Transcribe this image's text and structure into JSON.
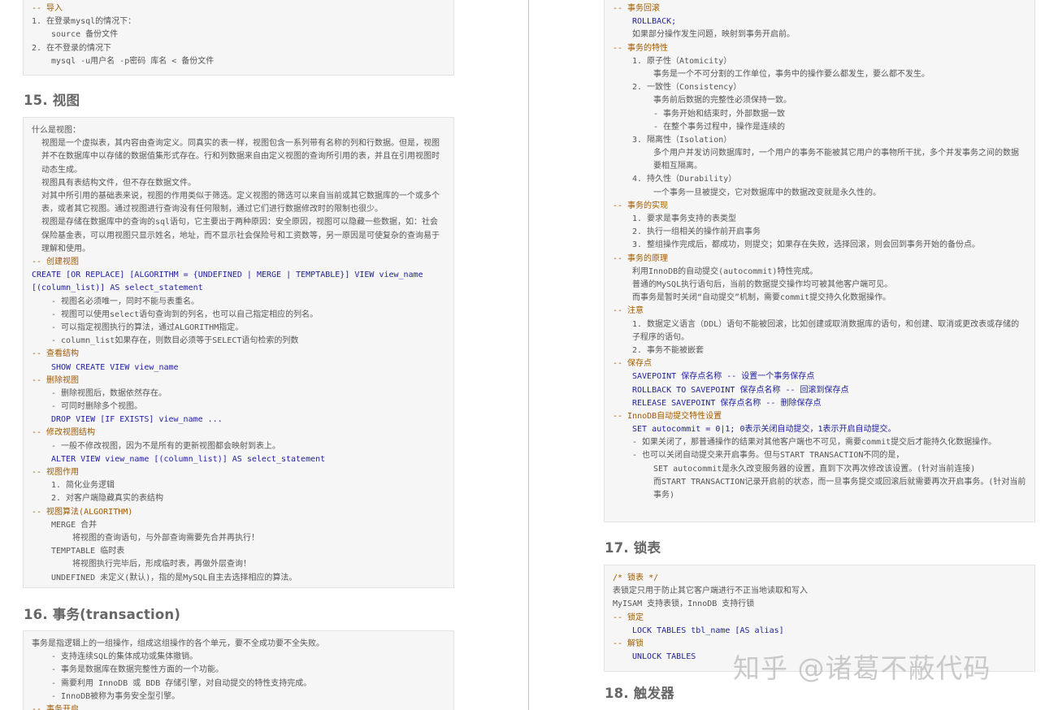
{
  "left": {
    "top_block": [
      {
        "t": "-- 导入",
        "cls": "c-comment"
      },
      {
        "t": "1. 在登录mysql的情况下：",
        "cls": "c-gray",
        "num": "1."
      },
      {
        "t": "source  备份文件",
        "cls": "c-gray",
        "ind": 2
      },
      {
        "t": "2. 在不登录的情况下",
        "cls": "c-gray",
        "num": "2."
      },
      {
        "t": "mysql -u用户名 -p密码 库名 < 备份文件",
        "cls": "c-gray",
        "ind": 2
      }
    ],
    "section15": {
      "title": "15. 视图",
      "lines": [
        {
          "t": "什么是视图：",
          "cls": "c-gray"
        },
        {
          "t": "视图是一个虚拟表，其内容由查询定义。同真实的表一样，视图包含一系列带有名称的列和行数据。但是，视图并不在数据库中以存储的数据值集形式存在。行和列数据来自由定义视图的查询所引用的表，并且在引用视图时动态生成。",
          "cls": "c-gray",
          "wrap": true,
          "ind": 1
        },
        {
          "t": "视图具有表结构文件，但不存在数据文件。",
          "cls": "c-gray",
          "ind": 1
        },
        {
          "t": "对其中所引用的基础表来说，视图的作用类似于筛选。定义视图的筛选可以来自当前或其它数据库的一个或多个表，或者其它视图。通过视图进行查询没有任何限制，通过它们进行数据修改时的限制也很少。",
          "cls": "c-gray",
          "wrap": true,
          "ind": 1
        },
        {
          "t": "视图是存储在数据库中的查询的sql语句，它主要出于两种原因：安全原因，视图可以隐藏一些数据，如：社会保险基金表，可以用视图只显示姓名，地址，而不显示社会保险号和工资数等，另一原因是可使复杂的查询易于理解和使用。",
          "cls": "c-gray",
          "wrap": true,
          "ind": 1
        },
        {
          "t": "-- 创建视图",
          "cls": "c-comment"
        },
        {
          "t": "CREATE [OR REPLACE] [ALGORITHM = {UNDEFINED | MERGE | TEMPTABLE}] VIEW view_name [(column_list)] AS select_statement",
          "cls": "c-kw",
          "wrap": true
        },
        {
          "t": "- 视图名必须唯一，同时不能与表重名。",
          "cls": "c-gray",
          "ind": 2
        },
        {
          "t": "- 视图可以使用select语句查询到的列名，也可以自己指定相应的列名。",
          "cls": "c-gray",
          "ind": 2
        },
        {
          "t": "- 可以指定视图执行的算法，通过ALGORITHM指定。",
          "cls": "c-gray",
          "ind": 2
        },
        {
          "t": "- column_list如果存在，则数目必须等于SELECT语句检索的列数",
          "cls": "c-gray",
          "ind": 2
        },
        {
          "t": "-- 查看结构",
          "cls": "c-comment"
        },
        {
          "t": "SHOW CREATE VIEW view_name",
          "cls": "c-kw",
          "ind": 2
        },
        {
          "t": "-- 删除视图",
          "cls": "c-comment"
        },
        {
          "t": "- 删除视图后，数据依然存在。",
          "cls": "c-gray",
          "ind": 2
        },
        {
          "t": "- 可同时删除多个视图。",
          "cls": "c-gray",
          "ind": 2
        },
        {
          "t": "DROP VIEW [IF EXISTS] view_name ...",
          "cls": "c-kw",
          "ind": 2
        },
        {
          "t": "-- 修改视图结构",
          "cls": "c-comment"
        },
        {
          "t": "- 一般不修改视图，因为不是所有的更新视图都会映射到表上。",
          "cls": "c-gray",
          "ind": 2
        },
        {
          "t": "ALTER VIEW view_name [(column_list)] AS select_statement",
          "cls": "c-kw",
          "ind": 2
        },
        {
          "t": "-- 视图作用",
          "cls": "c-comment"
        },
        {
          "t": "1. 简化业务逻辑",
          "cls": "c-gray",
          "ind": 2,
          "num": "1."
        },
        {
          "t": "2. 对客户端隐藏真实的表结构",
          "cls": "c-gray",
          "ind": 2,
          "num": "2."
        },
        {
          "t": "-- 视图算法(ALGORITHM)",
          "cls": "c-comment"
        },
        {
          "t": "MERGE        合并",
          "cls": "c-gray",
          "ind": 2
        },
        {
          "t": "将视图的查询语句，与外部查询需要先合并再执行！",
          "cls": "c-gray",
          "ind": 3
        },
        {
          "t": "TEMPTABLE    临时表",
          "cls": "c-gray",
          "ind": 2
        },
        {
          "t": "将视图执行完毕后，形成临时表，再做外层查询！",
          "cls": "c-gray",
          "ind": 3
        },
        {
          "t": "UNDEFINED    未定义(默认)，指的是MySQL自主去选择相应的算法。",
          "cls": "c-gray",
          "ind": 2
        }
      ]
    },
    "section16": {
      "title": "16. 事务(transaction)",
      "lines": [
        {
          "t": "事务是指逻辑上的一组操作，组成这组操作的各个单元，要不全成功要不全失败。",
          "cls": "c-gray"
        },
        {
          "t": "- 支持连续SQL的集体成功或集体撤销。",
          "cls": "c-gray",
          "ind": 2
        },
        {
          "t": "- 事务是数据库在数据完整性方面的一个功能。",
          "cls": "c-gray",
          "ind": 2
        },
        {
          "t": "- 需要利用 InnoDB 或 BDB 存储引擎，对自动提交的特性支持完成。",
          "cls": "c-gray",
          "ind": 2
        },
        {
          "t": "- InnoDB被称为事务安全型引擎。",
          "cls": "c-gray",
          "ind": 2
        },
        {
          "t": "-- 事务开启",
          "cls": "c-comment"
        }
      ]
    }
  },
  "right": {
    "top_block": [
      {
        "t": "-- 事务回滚",
        "cls": "c-comment"
      },
      {
        "t": "ROLLBACK;",
        "cls": "c-kw",
        "ind": 2
      },
      {
        "t": "如果部分操作发生问题，映射到事务开启前。",
        "cls": "c-gray",
        "ind": 2
      },
      {
        "t": "-- 事务的特性",
        "cls": "c-comment"
      },
      {
        "t": "1. 原子性（Atomicity）",
        "cls": "c-gray",
        "ind": 2,
        "num": "1."
      },
      {
        "t": "事务是一个不可分割的工作单位，事务中的操作要么都发生，要么都不发生。",
        "cls": "c-gray",
        "ind": 3
      },
      {
        "t": "2. 一致性（Consistency）",
        "cls": "c-gray",
        "ind": 2,
        "num": "2."
      },
      {
        "t": "事务前后数据的完整性必须保持一致。",
        "cls": "c-gray",
        "ind": 3
      },
      {
        "t": "- 事务开始和结束时，外部数据一致",
        "cls": "c-gray",
        "ind": 3
      },
      {
        "t": "- 在整个事务过程中，操作是连续的",
        "cls": "c-gray",
        "ind": 3
      },
      {
        "t": "3. 隔离性（Isolation）",
        "cls": "c-gray",
        "ind": 2,
        "num": "3."
      },
      {
        "t": "多个用户并发访问数据库时，一个用户的事务不能被其它用户的事物所干扰，多个并发事务之间的数据要相互隔离。",
        "cls": "c-gray",
        "ind": 3,
        "wrap": true
      },
      {
        "t": "4. 持久性（Durability）",
        "cls": "c-gray",
        "ind": 2,
        "num": "4."
      },
      {
        "t": "一个事务一旦被提交，它对数据库中的数据改变就是永久性的。",
        "cls": "c-gray",
        "ind": 3
      },
      {
        "t": "-- 事务的实现",
        "cls": "c-comment"
      },
      {
        "t": "1. 要求是事务支持的表类型",
        "cls": "c-gray",
        "ind": 2,
        "num": "1."
      },
      {
        "t": "2. 执行一组相关的操作前开启事务",
        "cls": "c-gray",
        "ind": 2,
        "num": "2."
      },
      {
        "t": "3. 整组操作完成后，都成功，则提交；如果存在失败，选择回滚，则会回到事务开始的备份点。",
        "cls": "c-gray",
        "ind": 2,
        "num": "3."
      },
      {
        "t": "-- 事务的原理",
        "cls": "c-comment"
      },
      {
        "t": "利用InnoDB的自动提交(autocommit)特性完成。",
        "cls": "c-gray",
        "ind": 2
      },
      {
        "t": "普通的MySQL执行语句后，当前的数据提交操作均可被其他客户端可见。",
        "cls": "c-gray",
        "ind": 2
      },
      {
        "t": "而事务是暂时关闭“自动提交”机制，需要commit提交持久化数据操作。",
        "cls": "c-gray",
        "ind": 2
      },
      {
        "t": "-- 注意",
        "cls": "c-comment"
      },
      {
        "t": "1. 数据定义语言（DDL）语句不能被回滚，比如创建或取消数据库的语句，和创建、取消或更改表或存储的子程序的语句。",
        "cls": "c-gray",
        "ind": 2,
        "wrap": true,
        "num": "1."
      },
      {
        "t": "2. 事务不能被嵌套",
        "cls": "c-gray",
        "ind": 2,
        "num": "2."
      },
      {
        "t": "-- 保存点",
        "cls": "c-comment"
      },
      {
        "t": "SAVEPOINT 保存点名称 -- 设置一个事务保存点",
        "cls": "c-kw",
        "ind": 2
      },
      {
        "t": "ROLLBACK TO SAVEPOINT 保存点名称 -- 回滚到保存点",
        "cls": "c-kw",
        "ind": 2
      },
      {
        "t": "RELEASE SAVEPOINT 保存点名称 -- 删除保存点",
        "cls": "c-kw",
        "ind": 2
      },
      {
        "t": "-- InnoDB自动提交特性设置",
        "cls": "c-comment"
      },
      {
        "t": "SET autocommit = 0|1;   0表示关闭自动提交，1表示开启自动提交。",
        "cls": "c-kw",
        "ind": 2
      },
      {
        "t": "- 如果关闭了，那普通操作的结果对其他客户端也不可见，需要commit提交后才能持久化数据操作。",
        "cls": "c-gray",
        "ind": 2
      },
      {
        "t": "- 也可以关闭自动提交来开启事务。但与START TRANSACTION不同的是，",
        "cls": "c-gray",
        "ind": 2
      },
      {
        "t": "SET autocommit是永久改变服务器的设置，直到下次再次修改该设置。(针对当前连接)",
        "cls": "c-gray",
        "ind": 3
      },
      {
        "t": "而START TRANSACTION记录开启前的状态，而一旦事务提交或回滚后就需要再次开启事务。(针对当前事务)",
        "cls": "c-gray",
        "ind": 3,
        "wrap": true
      }
    ],
    "section17": {
      "title": "17. 锁表",
      "lines": [
        {
          "t": "/* 锁表 */",
          "cls": "c-comment"
        },
        {
          "t": "表锁定只用于防止其它客户端进行不正当地读取和写入",
          "cls": "c-gray"
        },
        {
          "t": "MyISAM 支持表锁，InnoDB 支持行锁",
          "cls": "c-gray"
        },
        {
          "t": "-- 锁定",
          "cls": "c-comment"
        },
        {
          "t": "LOCK TABLES tbl_name [AS alias]",
          "cls": "c-kw",
          "ind": 2
        },
        {
          "t": "-- 解锁",
          "cls": "c-comment"
        },
        {
          "t": "UNLOCK TABLES",
          "cls": "c-kw",
          "ind": 2
        }
      ]
    },
    "section18": {
      "title": "18. 触发器"
    }
  },
  "watermark": "知乎 @诸葛不蔽代码"
}
